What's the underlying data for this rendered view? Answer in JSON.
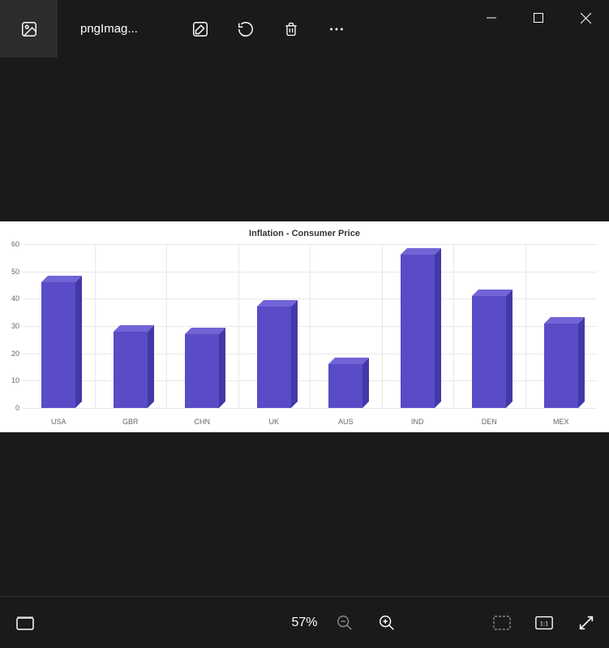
{
  "titlebar": {
    "filename": "pngImag..."
  },
  "bottombar": {
    "zoom": "57%"
  },
  "chart_data": {
    "type": "bar",
    "title": "Inflation - Consumer Price",
    "categories": [
      "USA",
      "GBR",
      "CHN",
      "UK",
      "AUS",
      "IND",
      "DEN",
      "MEX"
    ],
    "values": [
      46,
      28,
      27,
      37,
      16,
      56,
      41,
      31
    ],
    "xlabel": "",
    "ylabel": "",
    "ylim": [
      0,
      60
    ],
    "yticks": [
      0,
      10,
      20,
      30,
      40,
      50,
      60
    ]
  }
}
